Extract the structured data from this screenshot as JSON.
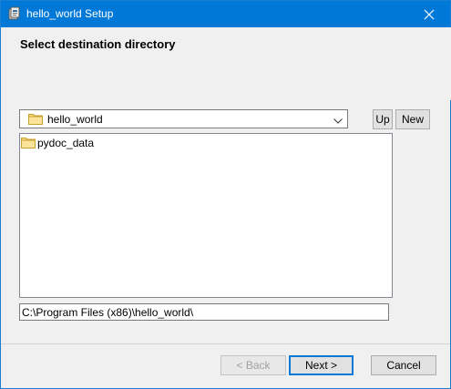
{
  "window": {
    "title": "hello_world Setup"
  },
  "header": {
    "heading": "Select destination directory"
  },
  "directory_combo": {
    "selected": "hello_world"
  },
  "toolbar": {
    "up_label": "Up",
    "new_label": "New"
  },
  "directory_list": {
    "items": [
      {
        "label": "pydoc_data"
      }
    ]
  },
  "path_field": {
    "value": "C:\\Program Files (x86)\\hello_world\\"
  },
  "footer": {
    "back_label": "< Back",
    "next_label": "Next >",
    "cancel_label": "Cancel"
  },
  "icons": {
    "app": "installer-icon",
    "close": "close-icon",
    "folder": "folder-icon",
    "dropdown": "chevron-down-icon"
  },
  "colors": {
    "titlebar": "#0078d7",
    "window_bg": "#f0f0f0",
    "folder_yellow": "#f8d775",
    "default_button_border": "#0078d7"
  }
}
